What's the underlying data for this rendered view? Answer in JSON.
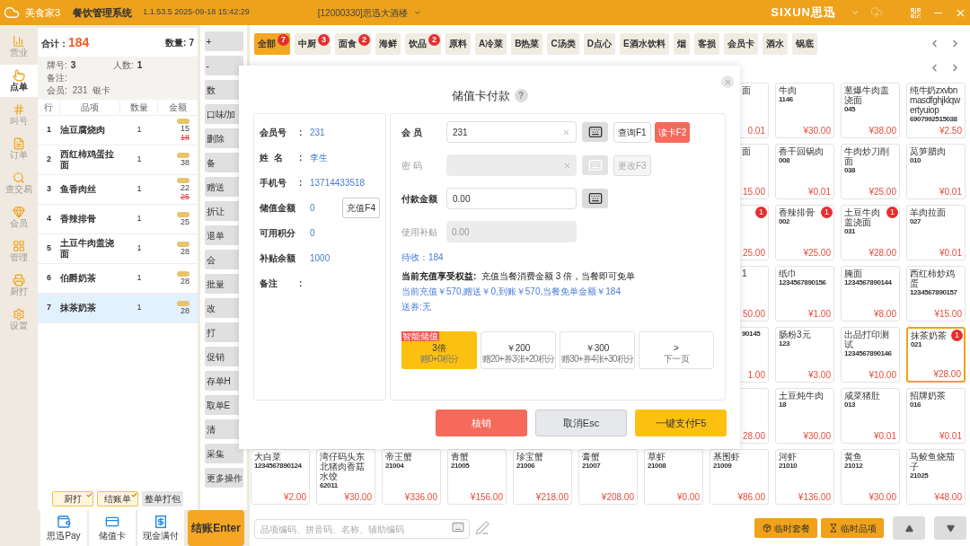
{
  "header": {
    "app_name": "美食家3",
    "system": "餐饮管理系统",
    "version": "1.1.53.5 2025-09-18 15:42:29",
    "store": "[12000330]思迅大酒楼",
    "brand": "SIXUN思迅"
  },
  "sidebar": {
    "items": [
      {
        "label": "营业",
        "kind": "chart",
        "selected": false
      },
      {
        "label": "点单",
        "kind": "hand",
        "selected": true
      },
      {
        "label": "叫号",
        "kind": "number",
        "selected": false
      },
      {
        "label": "订单",
        "kind": "list",
        "selected": false
      },
      {
        "label": "查交易",
        "kind": "search",
        "selected": false
      },
      {
        "label": "会员",
        "kind": "gem",
        "selected": false
      },
      {
        "label": "管理",
        "kind": "grid",
        "selected": false
      },
      {
        "label": "厨打",
        "kind": "print",
        "selected": false
      },
      {
        "label": "设置",
        "kind": "settings",
        "selected": false
      }
    ]
  },
  "order": {
    "total_label": "合计：",
    "total": "184",
    "count_label": "数量:",
    "count": "7",
    "info": [
      {
        "label": "牌号:",
        "value": "3"
      },
      {
        "label": "人数:",
        "value": "1"
      }
    ],
    "remark_label": "备注:",
    "member_label": "会员:",
    "member_value": "231",
    "member_level": "银卡",
    "columns": [
      "行",
      "品项",
      "数量",
      "金额"
    ],
    "rows": [
      {
        "no": "1",
        "name": "油豆腐烧肉",
        "qty": "1",
        "price": "15",
        "original": "18",
        "selected": false
      },
      {
        "no": "2",
        "name": "西红柿鸡蛋拉面",
        "qty": "1",
        "price": "38",
        "selected": false
      },
      {
        "no": "3",
        "name": "鱼香肉丝",
        "qty": "1",
        "price": "22",
        "original": "25",
        "selected": false
      },
      {
        "no": "4",
        "name": "香辣排骨",
        "qty": "1",
        "price": "25",
        "selected": false
      },
      {
        "no": "5",
        "name": "土豆牛肉盖浇面",
        "qty": "1",
        "price": "28",
        "selected": false
      },
      {
        "no": "6",
        "name": "伯爵奶茶",
        "qty": "1",
        "price": "28",
        "selected": false
      },
      {
        "no": "7",
        "name": "抹茶奶茶",
        "qty": "1",
        "price": "28",
        "selected": true
      }
    ],
    "print_options": [
      {
        "label": "厨打",
        "checked": true
      },
      {
        "label": "结账单",
        "checked": true
      },
      {
        "label": "整单打包",
        "checked": false
      }
    ],
    "payments": [
      {
        "label": "思迅Pay",
        "kind": "pay"
      },
      {
        "label": "储值卡",
        "kind": "card"
      },
      {
        "label": "现金满付",
        "kind": "cash"
      }
    ],
    "checkout": "结账Enter"
  },
  "actions": [
    "+",
    "-",
    "数",
    "口味/加",
    "删除",
    "备",
    "赠送",
    "折让",
    "退单",
    "会",
    "批量",
    "改",
    "打",
    "促销",
    "存单H",
    "取单E",
    "清",
    "采集",
    "更多操作"
  ],
  "categories": [
    {
      "label": "全部",
      "badge": "7",
      "selected": true
    },
    {
      "label": "中厨",
      "badge": "3",
      "selected": false
    },
    {
      "label": "面食",
      "badge": "2",
      "selected": false
    },
    {
      "label": "海鲜",
      "selected": false
    },
    {
      "label": "饮品",
      "badge": "2",
      "selected": false
    },
    {
      "label": "原料",
      "selected": false
    },
    {
      "label": "A冷菜",
      "selected": false
    },
    {
      "label": "B热菜",
      "selected": false
    },
    {
      "label": "C汤类",
      "selected": false
    },
    {
      "label": "D点心",
      "selected": false
    },
    {
      "label": "E酒水饮料",
      "selected": false
    },
    {
      "label": "烟",
      "selected": false
    },
    {
      "label": "客损",
      "selected": false
    },
    {
      "label": "会员卡",
      "selected": false
    },
    {
      "label": "酒水",
      "selected": false
    },
    {
      "label": "锅底",
      "selected": false
    }
  ],
  "product_grid": [
    [
      {
        "kind": "clipped",
        "name": "面",
        "price": "0.01",
        "selected": false
      },
      {
        "kind": "full",
        "name": "牛肉",
        "code": "1146",
        "price": "¥30.00",
        "selected": false
      },
      {
        "kind": "full",
        "name": "葱爆牛肉盖浇面",
        "code": "045",
        "price": "¥38.00",
        "selected": false
      },
      {
        "kind": "full",
        "name": "纯牛奶zxvbnmasdfghjklqwertyuiop",
        "code": "6907992515038",
        "price": "¥2.50",
        "selected": false
      }
    ],
    [
      {
        "kind": "clipped",
        "name": "面",
        "price": "15.00",
        "selected": false
      },
      {
        "kind": "full",
        "name": "香干回锅肉",
        "code": "008",
        "price": "¥0.01",
        "selected": false
      },
      {
        "kind": "full",
        "name": "牛肉炒刀削面",
        "code": "038",
        "price": "¥25.00",
        "selected": false
      },
      {
        "kind": "full",
        "name": "莴笋腊肉",
        "code": "010",
        "price": "¥0.01",
        "selected": false
      }
    ],
    [
      {
        "kind": "clipped",
        "badge": "1",
        "price": "25.00",
        "selected": false
      },
      {
        "kind": "full",
        "name": "香辣排骨",
        "code": "002",
        "price": "¥25.00",
        "badge": "1",
        "selected": false
      },
      {
        "kind": "full",
        "name": "土豆牛肉盖浇面",
        "code": "031",
        "price": "¥28.00",
        "badge": "1",
        "selected": false
      },
      {
        "kind": "full",
        "name": "羊肉拉面",
        "code": "027",
        "price": "¥0.01",
        "selected": false
      }
    ],
    [
      {
        "kind": "clipped",
        "name": "1",
        "price": "50.00",
        "selected": false
      },
      {
        "kind": "full",
        "name": "纸巾",
        "code": "1234567890156",
        "price": "¥1.00",
        "selected": false
      },
      {
        "kind": "full",
        "name": "腌面",
        "code": "1234567890144",
        "price": "¥8.00",
        "selected": false
      },
      {
        "kind": "full",
        "name": "西红柿炒鸡蛋",
        "code": "1234567890157",
        "price": "¥15.00",
        "selected": false
      }
    ],
    [
      {
        "kind": "clipped",
        "code": "90145",
        "price": "1.00",
        "selected": false
      },
      {
        "kind": "full",
        "name": "肠粉3元",
        "code": "123",
        "price": "¥3.00",
        "selected": false
      },
      {
        "kind": "full",
        "name": "出品打印测试",
        "code": "1234567890146",
        "price": "¥10.00",
        "selected": false
      },
      {
        "kind": "full",
        "name": "抹茶奶茶",
        "code": "021",
        "price": "¥28.00",
        "badge": "1",
        "selected": true
      }
    ],
    [
      {
        "kind": "clipped",
        "price": "28.00",
        "selected": false
      },
      {
        "kind": "full",
        "name": "土豆炖牛肉",
        "code": "18",
        "price": "¥30.00",
        "selected": false
      },
      {
        "kind": "full",
        "name": "咸菜猪肚",
        "code": "013",
        "price": "¥0.01",
        "selected": false
      },
      {
        "kind": "full",
        "name": "招牌奶茶",
        "code": "016",
        "price": "¥0.01",
        "selected": false
      }
    ]
  ],
  "bottom_products": [
    {
      "name": "大白菜",
      "code": "1234567890124",
      "price": "¥2.00",
      "selected": false
    },
    {
      "name": "湾仔码头东北猪肉香菇水饺",
      "code": "62011",
      "price": "¥30.00",
      "selected": false
    },
    {
      "name": "帝王蟹",
      "code": "21004",
      "price": "¥336.00",
      "selected": false
    },
    {
      "name": "青蟹",
      "code": "21005",
      "price": "¥156.00",
      "selected": false
    },
    {
      "name": "珍宝蟹",
      "code": "21006",
      "price": "¥218.00",
      "selected": false
    },
    {
      "name": "膏蟹",
      "code": "21007",
      "price": "¥208.00",
      "selected": false
    },
    {
      "name": "草虾",
      "code": "21008",
      "price": "¥0.00",
      "selected": false
    },
    {
      "name": "基围虾",
      "code": "21009",
      "price": "¥86.00",
      "selected": false
    },
    {
      "name": "河虾",
      "code": "21010",
      "price": "¥136.00",
      "selected": false
    },
    {
      "name": "黄鱼",
      "code": "21012",
      "price": "¥30.00",
      "selected": false
    },
    {
      "name": "马鲛鱼烧茄子",
      "code": "21025",
      "price": "¥48.00",
      "selected": false
    }
  ],
  "search": {
    "placeholder": "品项编码、拼音码、名称、辅助编码"
  },
  "quick_buttons": [
    {
      "label": "临时套餐",
      "kind": "set"
    },
    {
      "label": "临时品项",
      "kind": "item"
    }
  ],
  "dialog": {
    "title": "储值卡付款",
    "help": "?",
    "member_info": [
      {
        "label": "会员号",
        "sep": ":",
        "value": "231"
      },
      {
        "label": "姓  名",
        "sep": ":",
        "value": "李生"
      },
      {
        "label": "手机号",
        "sep": ":",
        "value": "13714433518"
      },
      {
        "label": "储值金额",
        "value": "0"
      },
      {
        "label": "可用积分",
        "value": "0"
      },
      {
        "label": "补贴余额",
        "value": "1000"
      },
      {
        "label": "备注",
        "sep": ":"
      }
    ],
    "recharge_button": "充值F4",
    "fields": [
      {
        "label": "会 员",
        "value": "231",
        "disabled": false,
        "clearable": true,
        "keyboard": true,
        "buttons": [
          {
            "label": "查询F1",
            "kind": "plain",
            "disabled": false
          },
          {
            "label": "读卡F2",
            "kind": "danger",
            "disabled": false
          }
        ]
      },
      {
        "label": "密 码",
        "disabled": true,
        "clearable": true,
        "keyboard": true,
        "buttons": [
          {
            "label": "更改F3",
            "kind": "plain",
            "disabled": true
          }
        ]
      },
      {
        "label": "付款金额",
        "value": "0.00",
        "disabled": false,
        "clearable": false,
        "keyboard": true
      },
      {
        "label": "使用补贴",
        "value": "0.00",
        "disabled": true,
        "clearable": false,
        "keyboard": false
      }
    ],
    "pending": "待收：184",
    "benefit": "**当前充值享受权益:**  充值当餐消费金额 3 倍，当餐即可免单",
    "detail": "当前充值￥570,赠送￥0,到账￥570,当餐免单金额￥184",
    "coupon": "送券:无",
    "options": [
      {
        "title": "3倍",
        "sub": "赠0+0积分",
        "tag": "智能储值",
        "selected": true
      },
      {
        "title": "￥200",
        "sub": "赠20+券3张+20积分",
        "selected": false
      },
      {
        "title": "￥300",
        "sub": "赠30+券4张+30积分",
        "selected": false
      },
      {
        "title": ">",
        "sub": "下一页",
        "selected": false
      }
    ],
    "footer": [
      {
        "label": "核销",
        "kind": "danger"
      },
      {
        "label": "取消Esc",
        "kind": "cancel"
      },
      {
        "label": "一键支付F5",
        "kind": "primary"
      }
    ]
  }
}
